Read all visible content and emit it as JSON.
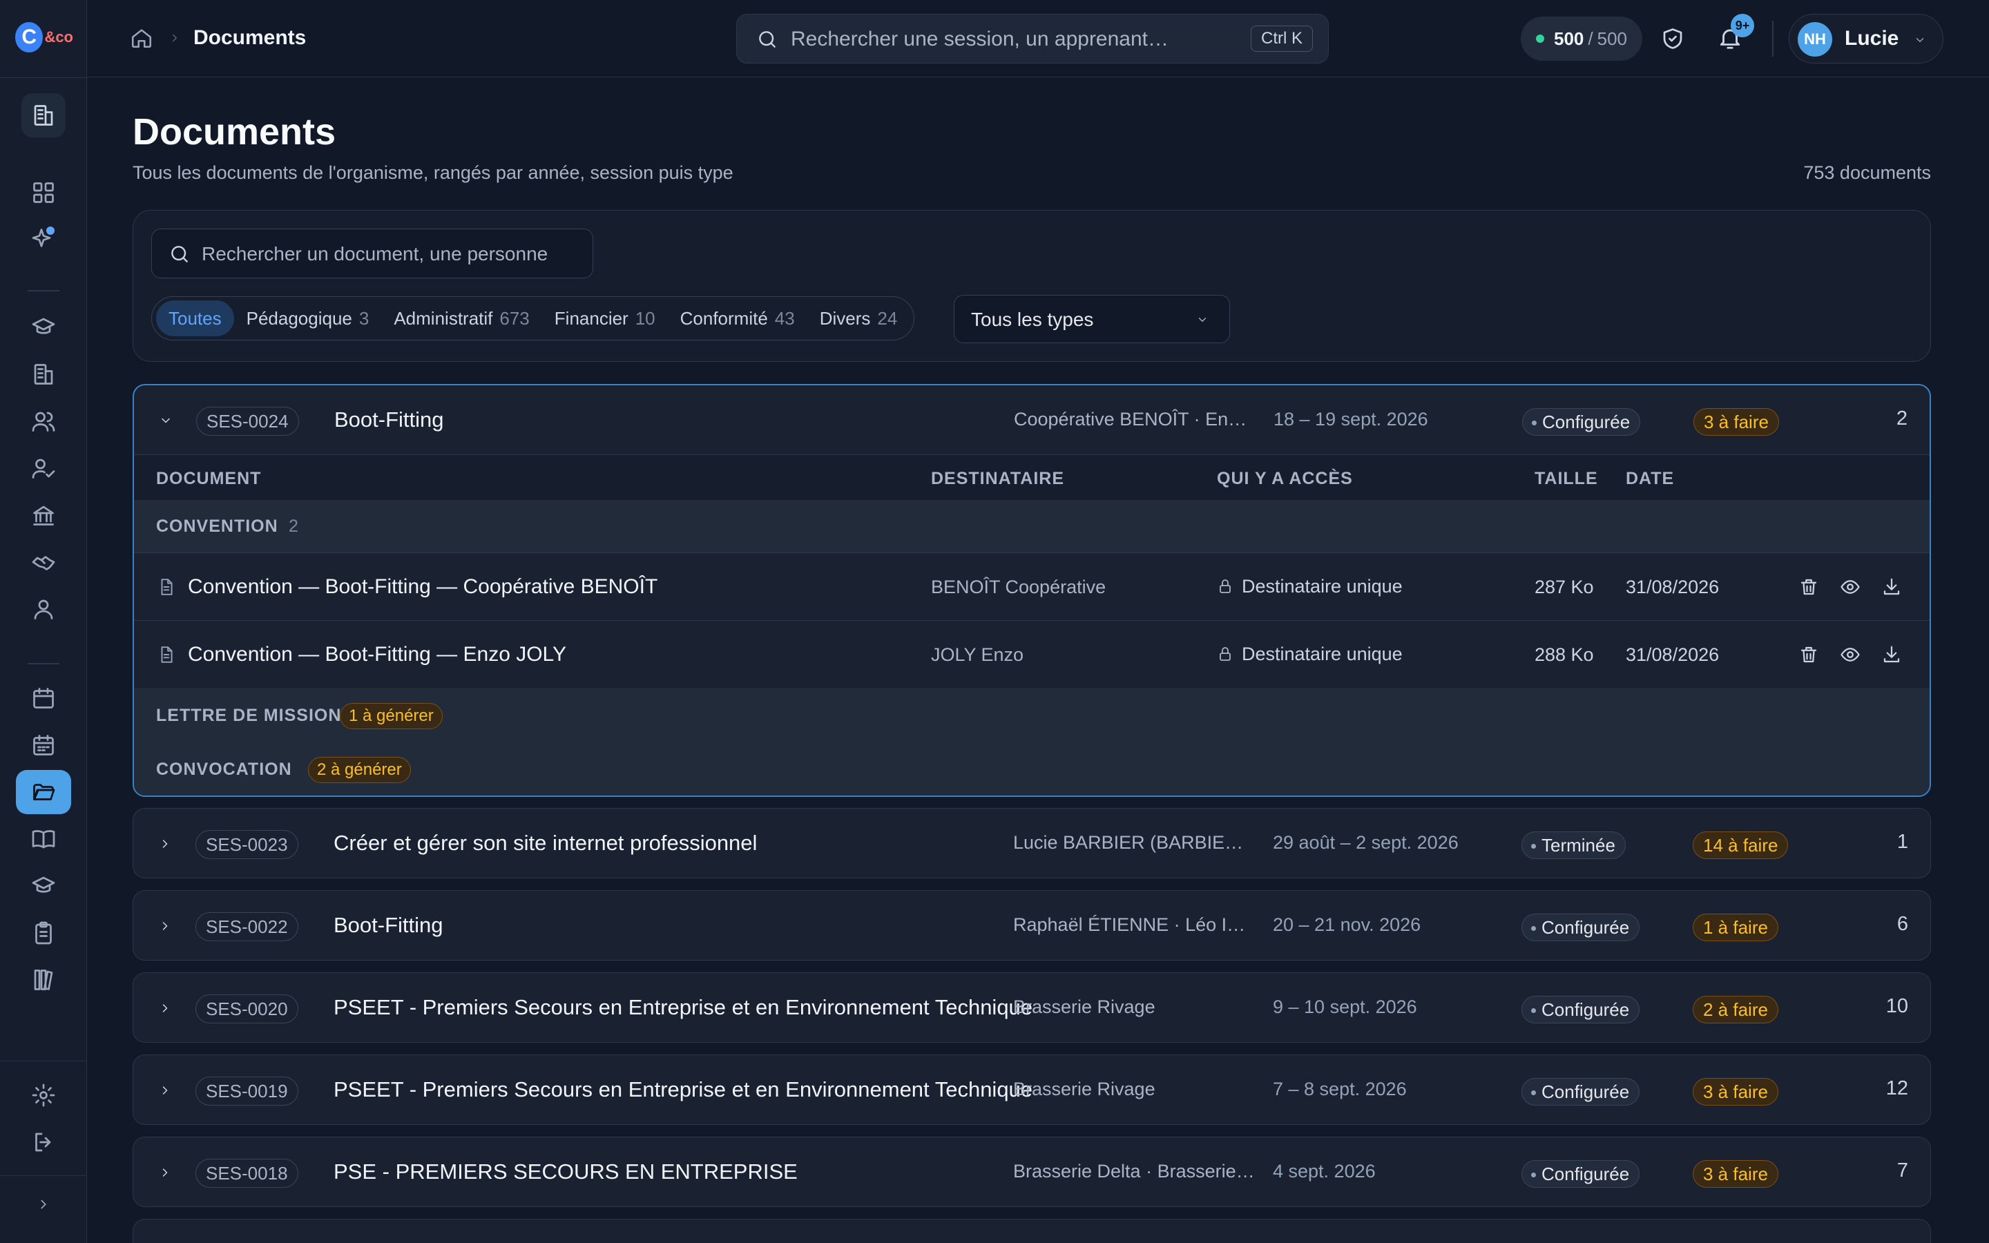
{
  "app": {
    "logo_text": "&co",
    "logo_mark": "C"
  },
  "sidebar": {
    "items": [
      {
        "name": "dashboard-icon"
      },
      {
        "name": "sparkles-icon"
      },
      {
        "name": "graduation-cap-icon"
      },
      {
        "name": "building-icon"
      },
      {
        "name": "users-icon"
      },
      {
        "name": "user-check-icon"
      },
      {
        "name": "bank-icon"
      },
      {
        "name": "handshake-icon"
      },
      {
        "name": "contacts-icon"
      },
      {
        "name": "calendar-icon"
      },
      {
        "name": "calendar-grid-icon"
      },
      {
        "name": "folder-icon"
      },
      {
        "name": "book-icon"
      },
      {
        "name": "cap-icon"
      },
      {
        "name": "clipboard-icon"
      },
      {
        "name": "library-icon"
      },
      {
        "name": "settings-icon"
      },
      {
        "name": "logout-icon"
      },
      {
        "name": "expand-icon"
      }
    ]
  },
  "topbar": {
    "breadcrumb_title": "Documents",
    "search_placeholder": "Rechercher une session, un apprenant…",
    "search_shortcut": "Ctrl K",
    "credits_used": "500",
    "credits_sep": "/",
    "credits_total": "500",
    "notif_badge": "9+",
    "user_initials": "NH",
    "user_name": "Lucie"
  },
  "page": {
    "title": "Documents",
    "subtitle": "Tous les documents de l'organisme, rangés par année, session puis type",
    "count": "753 documents"
  },
  "filters": {
    "search_placeholder": "Rechercher un document, une personne",
    "tabs": [
      {
        "label": "Toutes",
        "count": ""
      },
      {
        "label": "Pédagogique",
        "count": "3"
      },
      {
        "label": "Administratif",
        "count": "673"
      },
      {
        "label": "Financier",
        "count": "10"
      },
      {
        "label": "Conformité",
        "count": "43"
      },
      {
        "label": "Divers",
        "count": "24"
      }
    ],
    "type_select": "Tous les types"
  },
  "table_headers": {
    "document": "DOCUMENT",
    "recipient": "DESTINATAIRE",
    "access": "QUI Y A ACCÈS",
    "size": "TAILLE",
    "date": "DATE"
  },
  "sessions": [
    {
      "code": "SES-0024",
      "title": "Boot-Fitting",
      "client": "Coopérative BENOÎT · Enzo JOLY",
      "dates": "18 – 19 sept. 2026",
      "status": "Configurée",
      "todo": "3 à faire",
      "count": "2",
      "groups": [
        {
          "label": "CONVENTION",
          "count": "2",
          "badge": "",
          "docs": [
            {
              "name": "Convention — Boot-Fitting — Coopérative BENOÎT",
              "recipient": "BENOÎT Coopérative",
              "access": "Destinataire unique",
              "size": "287 Ko",
              "date": "31/08/2026"
            },
            {
              "name": "Convention — Boot-Fitting — Enzo JOLY",
              "recipient": "JOLY Enzo",
              "access": "Destinataire unique",
              "size": "288 Ko",
              "date": "31/08/2026"
            }
          ]
        },
        {
          "label": "LETTRE DE MISSION",
          "count": "",
          "badge": "1 à générer"
        },
        {
          "label": "CONVOCATION",
          "count": "",
          "badge": "2 à générer"
        }
      ]
    },
    {
      "code": "SES-0023",
      "title": "Créer et gérer son site internet professionnel",
      "client": "Lucie BARBIER (BARBIER D…",
      "dates": "29 août – 2 sept. 2026",
      "status": "Terminée",
      "todo": "14 à faire",
      "count": "1"
    },
    {
      "code": "SES-0022",
      "title": "Boot-Fitting",
      "client": "Raphaël ÉTIENNE · Léo INÈ…",
      "dates": "20 – 21 nov. 2026",
      "status": "Configurée",
      "todo": "1 à faire",
      "count": "6"
    },
    {
      "code": "SES-0020",
      "title": "PSEET - Premiers Secours en Entreprise et en Environnement Technique",
      "client": "Brasserie Rivage",
      "dates": "9 – 10 sept. 2026",
      "status": "Configurée",
      "todo": "2 à faire",
      "count": "10"
    },
    {
      "code": "SES-0019",
      "title": "PSEET - Premiers Secours en Entreprise et en Environnement Technique",
      "client": "Brasserie Rivage",
      "dates": "7 – 8 sept. 2026",
      "status": "Configurée",
      "todo": "3 à faire",
      "count": "12"
    },
    {
      "code": "SES-0018",
      "title": "PSE - PREMIERS SECOURS EN ENTREPRISE",
      "client": "Brasserie Delta · Brasserie …",
      "dates": "4 sept. 2026",
      "status": "Configurée",
      "todo": "3 à faire",
      "count": "7"
    }
  ],
  "colors": {
    "accent": "#4ea3e8",
    "warning": "#fbbf24",
    "background": "#111827",
    "card": "#1a2232"
  }
}
